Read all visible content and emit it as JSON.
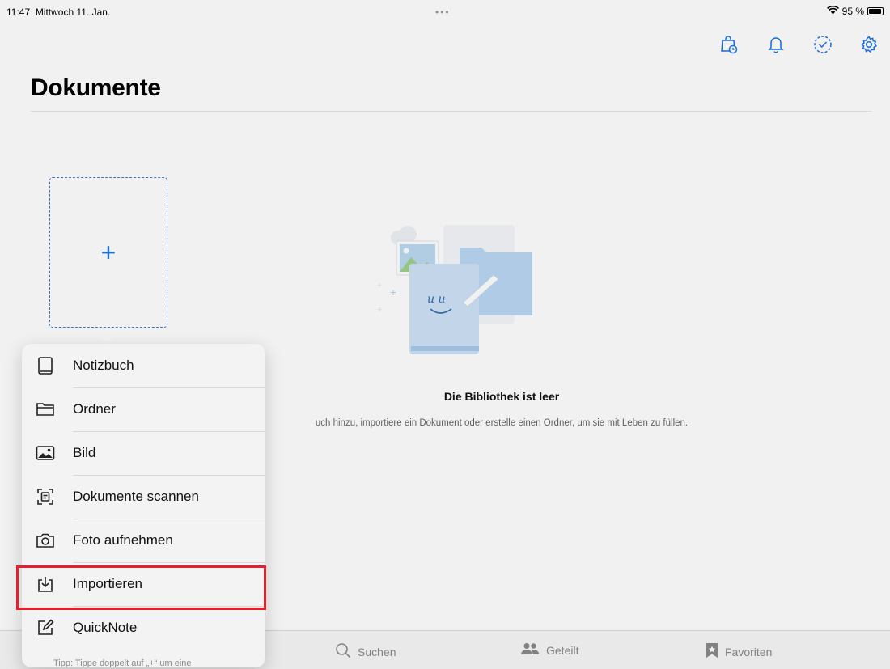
{
  "status_bar": {
    "time": "11:47",
    "date": "Mittwoch 11. Jan.",
    "dots": "•••",
    "battery": "95 %",
    "battery_level": 0.95,
    "wifi_icon": "wifi-icon"
  },
  "toolbar": {
    "icons": [
      "shopping-bag-clock-icon",
      "bell-icon",
      "checkmark-circle-icon",
      "gear-icon"
    ],
    "accent": "#1a73e8"
  },
  "page": {
    "title": "Dokumente"
  },
  "empty_state": {
    "title": "Die Bibliothek ist leer",
    "subtitle": "uch hinzu, importiere ein Dokument oder erstelle einen Ordner, um sie mit Leben zu füllen."
  },
  "add_tile": {
    "label": "+"
  },
  "menu": {
    "items": [
      {
        "label": "Notizbuch",
        "icon": "notebook-icon"
      },
      {
        "label": "Ordner",
        "icon": "folder-icon"
      },
      {
        "label": "Bild",
        "icon": "image-icon"
      },
      {
        "label": "Dokumente scannen",
        "icon": "scan-document-icon"
      },
      {
        "label": "Foto aufnehmen",
        "icon": "camera-icon"
      },
      {
        "label": "Importieren",
        "icon": "import-icon"
      },
      {
        "label": "QuickNote",
        "icon": "quicknote-icon"
      }
    ],
    "tip": "Tipp: Tippe doppelt auf „+“ um eine",
    "highlighted_item": "Importieren",
    "highlight_color": "#e5202c"
  },
  "tab_bar": {
    "tabs": [
      {
        "label": "Suchen",
        "icon": "search-icon"
      },
      {
        "label": "Geteilt",
        "icon": "people-icon"
      },
      {
        "label": "Favoriten",
        "icon": "bookmark-star-icon"
      }
    ]
  }
}
